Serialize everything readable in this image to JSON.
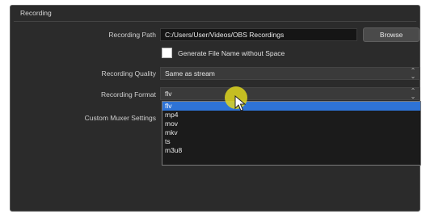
{
  "section": {
    "title": "Recording"
  },
  "recording_path": {
    "label": "Recording Path",
    "value": "C:/Users/User/Videos/OBS Recordings",
    "browse_label": "Browse"
  },
  "filename_option": {
    "label": "Generate File Name without Space",
    "checked": false
  },
  "recording_quality": {
    "label": "Recording Quality",
    "value": "Same as stream"
  },
  "recording_format": {
    "label": "Recording Format",
    "value": "flv",
    "options": [
      "flv",
      "mp4",
      "mov",
      "mkv",
      "ts",
      "m3u8"
    ],
    "highlighted": "flv"
  },
  "custom_muxer": {
    "label": "Custom Muxer Settings"
  },
  "colors": {
    "panel_bg": "#2b2b2b",
    "selection": "#2e73d6",
    "cursor_highlight": "#ded61e"
  }
}
